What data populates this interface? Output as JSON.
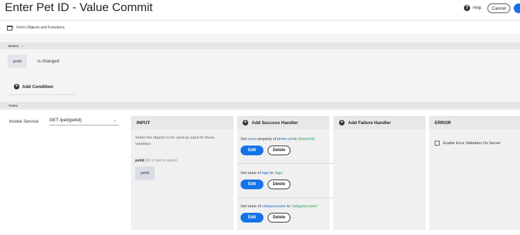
{
  "header": {
    "title": "Enter Pet ID - Value Commit",
    "help_label": "Help",
    "cancel_label": "Cancel"
  },
  "form_objects": {
    "label": "Form Objects and Functions"
  },
  "when": {
    "section_label": "WHEN",
    "field_chip": "petId",
    "condition_text": "is changed",
    "add_condition_label": "Add Condition"
  },
  "then": {
    "section_label": "THEN",
    "invoke_label": "Invoke Service",
    "service_value": "GET /pet/{petId}"
  },
  "input_panel": {
    "title": "INPUT",
    "description": "Select the objects to be used as input for these variables",
    "arg_name": "petId",
    "arg_hint": "(ID of pet to return)",
    "arg_value": "petId"
  },
  "success_panel": {
    "title": "Add Success Handler",
    "handlers": [
      {
        "prefix": "Set ",
        "keyword": "enum",
        "middle": " property of ",
        "target": "photo-url",
        "to": " to ",
        "value": "'photoUrls'"
      },
      {
        "prefix": "Set value of ",
        "target": "tags",
        "to": " to ",
        "value": "'tags'"
      },
      {
        "prefix": "Set value of ",
        "target": "categoryname",
        "to": " to ",
        "value": "'category.name'"
      }
    ],
    "edit_label": "Edit",
    "delete_label": "Delete"
  },
  "failure_panel": {
    "title": "Add Failure Handler"
  },
  "error_panel": {
    "title": "ERROR",
    "checkbox_label": "Enable Error Validation On Server",
    "checkbox_checked": false
  },
  "colors": {
    "accent": "#1473e6",
    "object_link": "#1a6fc9",
    "value_literal": "#2d9d5b"
  }
}
